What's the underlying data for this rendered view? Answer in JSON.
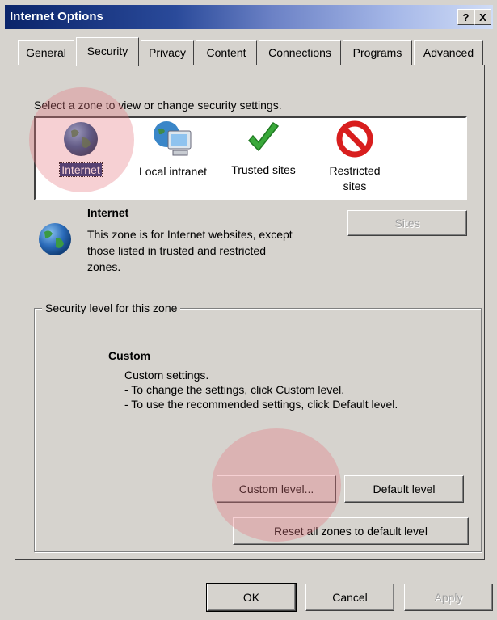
{
  "window": {
    "title": "Internet Options",
    "help_label": "?",
    "close_label": "X"
  },
  "tabs": [
    "General",
    "Security",
    "Privacy",
    "Content",
    "Connections",
    "Programs",
    "Advanced"
  ],
  "active_tab": "Security",
  "zones_prompt": "Select a zone to view or change security settings.",
  "zones": [
    {
      "label": "Internet",
      "icon": "globe-icon",
      "selected": true
    },
    {
      "label": "Local intranet",
      "icon": "intranet-computer-icon"
    },
    {
      "label": "Trusted sites",
      "icon": "checkmark-icon"
    },
    {
      "label": "Restricted sites",
      "icon": "prohibited-icon"
    }
  ],
  "zone_info": {
    "title": "Internet",
    "description": "This zone is for Internet websites, except those listed in trusted and restricted zones.",
    "sites_button": "Sites"
  },
  "security_level": {
    "group_label": "Security level for this zone",
    "level_title": "Custom",
    "level_lines": [
      "Custom settings.",
      "- To change the settings, click Custom level.",
      "- To use the recommended settings, click Default level."
    ],
    "custom_button": "Custom level...",
    "default_button": "Default level",
    "reset_button": "Reset all zones to default level"
  },
  "footer": {
    "ok": "OK",
    "cancel": "Cancel",
    "apply": "Apply"
  },
  "colors": {
    "dialog_bg": "#d6d3ce",
    "title_bar": "#0a246a",
    "highlight": "#e67882"
  }
}
